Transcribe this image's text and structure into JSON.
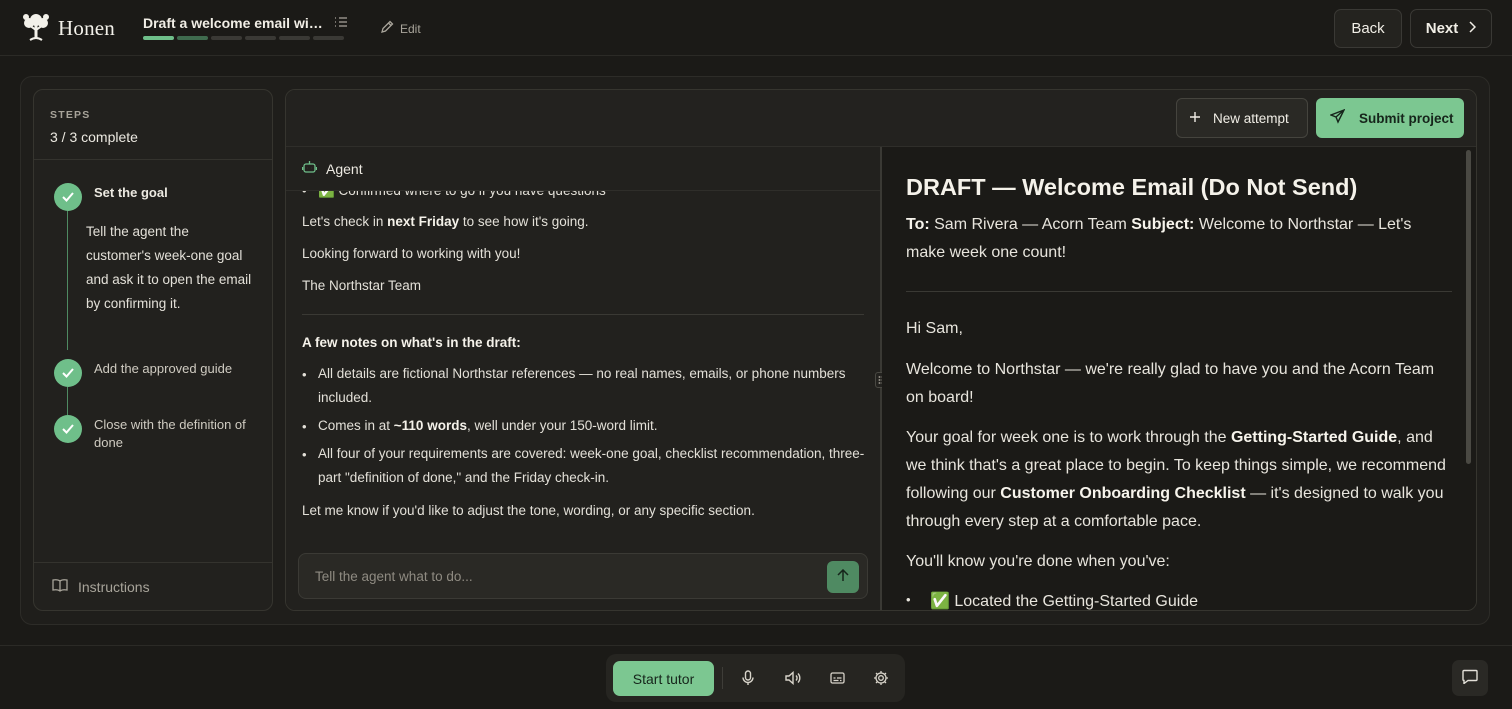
{
  "header": {
    "brand": "Honen",
    "project_title": "Draft a welcome email wit...",
    "progress": {
      "total_segments": 6,
      "completed_segments": 1,
      "partial_segments": 1
    },
    "edit_label": "Edit",
    "back_label": "Back",
    "next_label": "Next"
  },
  "steps": {
    "heading": "STEPS",
    "count": "3 / 3 complete",
    "items": [
      {
        "title": "Set the goal",
        "description": "Tell the agent the customer's week-one goal and ask it to open the email by confirming it.",
        "done": true
      },
      {
        "title": "Add the approved guide",
        "done": true
      },
      {
        "title": "Close with the definition of done",
        "done": true
      }
    ],
    "instructions_label": "Instructions"
  },
  "workspace": {
    "new_attempt_label": "New attempt",
    "submit_label": "Submit project"
  },
  "agent": {
    "title": "Agent",
    "partial_top": "✅ Confirmed where to go if you have questions",
    "checkin_pre": "Let's check in ",
    "checkin_bold": "next Friday",
    "checkin_post": " to see how it's going.",
    "closing": "Looking forward to working with you!",
    "signoff": "The Northstar Team",
    "notes_heading": "A few notes on what's in the draft:",
    "note1": "All details are fictional Northstar references — no real names, emails, or phone numbers included.",
    "note2_pre": "Comes in at ",
    "note2_bold": "~110 words",
    "note2_post": ", well under your 150-word limit.",
    "note3": "All four of your requirements are covered: week-one goal, checklist recommendation, three-part \"definition of done,\" and the Friday check-in.",
    "footer": "Let me know if you'd like to adjust the tone, wording, or any specific section.",
    "input_placeholder": "Tell the agent what to do..."
  },
  "draft": {
    "title": "DRAFT — Welcome Email (Do Not Send)",
    "to_label": "To:",
    "to_value": " Sam Rivera — Acorn Team ",
    "subject_label": "Subject:",
    "subject_value": " Welcome to Northstar — Let's make week one count!",
    "greeting": "Hi Sam,",
    "p1": "Welcome to Northstar — we're really glad to have you and the Acorn Team on board!",
    "p2_a": "Your goal for week one is to work through the ",
    "p2_b": "Getting-Started Guide",
    "p2_c": ", and we think that's a great place to begin. To keep things simple, we recommend following our ",
    "p2_d": "Customer Onboarding Checklist",
    "p2_e": " — it's designed to walk you through every step at a comfortable pace.",
    "p3": "You'll know you're done when you've:",
    "bullet1": "✅ Located the Getting-Started Guide"
  },
  "bottom": {
    "start_tutor_label": "Start tutor",
    "icons": [
      "microphone-icon",
      "speaker-icon",
      "captions-icon",
      "settings-icon"
    ]
  },
  "colors": {
    "accent": "#7cc791",
    "background": "#1b1a17",
    "panel": "#22211e"
  }
}
